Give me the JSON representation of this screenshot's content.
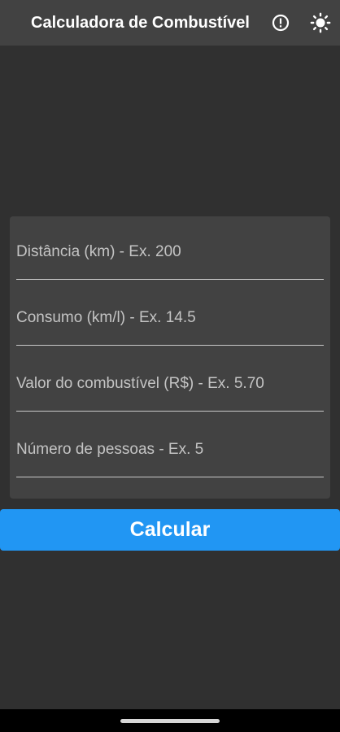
{
  "app_bar": {
    "title": "Calculadora de Combustível",
    "info_icon": "info-alert-icon",
    "theme_icon": "brightness-sun-icon"
  },
  "form": {
    "distance": {
      "value": "",
      "placeholder": "Distância (km) - Ex. 200"
    },
    "consumption": {
      "value": "",
      "placeholder": "Consumo (km/l) - Ex. 14.5"
    },
    "fuel_price": {
      "value": "",
      "placeholder": "Valor do combustível (R$) - Ex. 5.70"
    },
    "people": {
      "value": "",
      "placeholder": "Número de pessoas - Ex. 5"
    }
  },
  "actions": {
    "calculate_label": "Calcular"
  },
  "colors": {
    "background": "#303030",
    "surface": "#424242",
    "accent": "#2196f3",
    "text": "#ffffff"
  }
}
